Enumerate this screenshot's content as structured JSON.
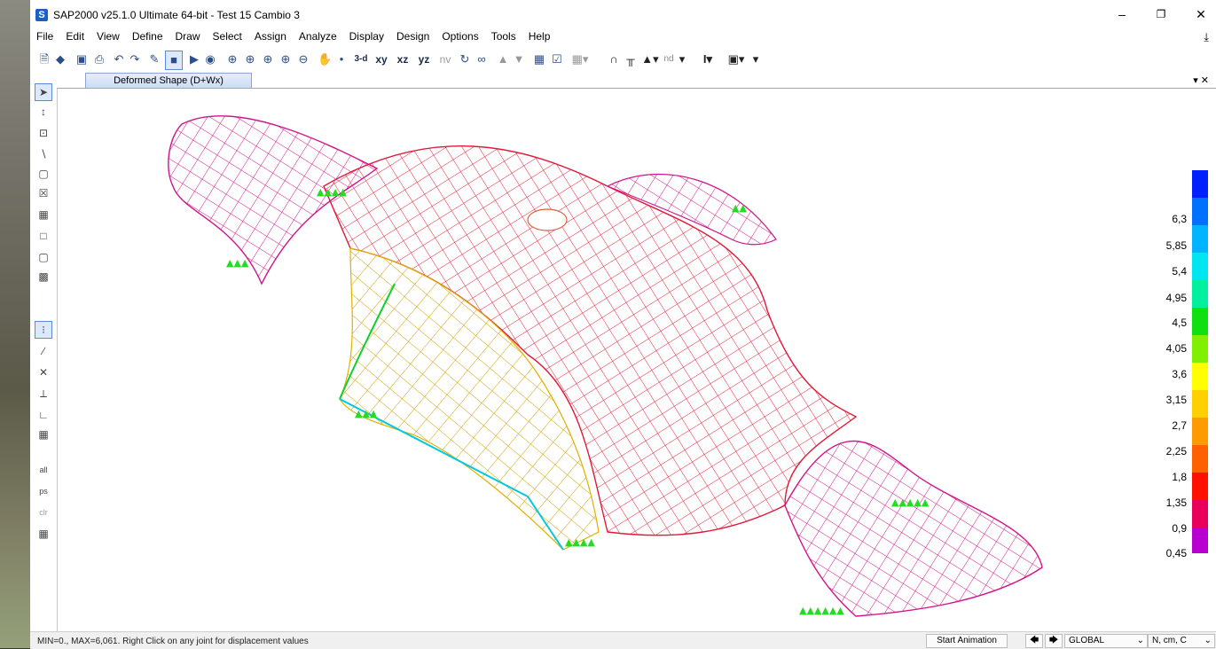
{
  "window": {
    "title": "SAP2000 v25.1.0 Ultimate 64-bit - Test 15 Cambio 3",
    "logo": "S"
  },
  "menu": [
    "File",
    "Edit",
    "View",
    "Define",
    "Draw",
    "Select",
    "Assign",
    "Analyze",
    "Display",
    "Design",
    "Options",
    "Tools",
    "Help"
  ],
  "toolbar": {
    "view_3d": "3-d",
    "view_xy": "xy",
    "view_xz": "xz",
    "view_yz": "yz",
    "view_nv": "nv",
    "nd": "nd",
    "icons": [
      "new-icon",
      "open-icon",
      "save-icon",
      "print-icon",
      "undo-icon",
      "redo-icon",
      "edit-icon",
      "lock-icon",
      "run-icon",
      "run-options-icon",
      "zoom-window-icon",
      "zoom-restore-icon",
      "zoom-previous-icon",
      "zoom-in-icon",
      "zoom-out-icon",
      "pan-icon",
      "pointer-icon",
      "rotate-icon",
      "perspective-icon",
      "up-icon",
      "down-icon",
      "grid-icon",
      "check-icon",
      "display-options-icon",
      "frame-icon",
      "portal-icon",
      "truss-icon",
      "section-icon",
      "box-icon"
    ]
  },
  "view": {
    "tab_label": "Deformed Shape (D+Wx)"
  },
  "legend": {
    "labels": [
      "6,3",
      "5,85",
      "5,4",
      "4,95",
      "4,5",
      "4,05",
      "3,6",
      "3,15",
      "2,7",
      "2,25",
      "1,8",
      "1,35",
      "0,9",
      "0,45"
    ],
    "colors": [
      "#0020ff",
      "#0070ff",
      "#00b4ff",
      "#00e6f0",
      "#00f0a0",
      "#10e010",
      "#80f000",
      "#ffff00",
      "#ffd000",
      "#ff9a00",
      "#ff6000",
      "#ff1000",
      "#e8005a",
      "#b800d0"
    ]
  },
  "status": {
    "message": "MIN=0., MAX=6,061. Right Click on any joint for displacement values",
    "animation_button": "Start Animation",
    "coord_system": "GLOBAL",
    "units": "N, cm, C"
  }
}
